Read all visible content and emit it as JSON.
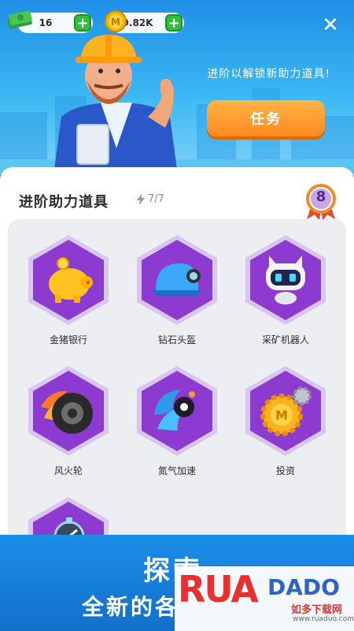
{
  "resources": {
    "cash_value": "16",
    "coin_value": "9.82K",
    "plus_label": "+"
  },
  "hero": {
    "prompt": "进阶以解锁新助力道具!",
    "task_button": "任务",
    "close_label": "✕"
  },
  "panel": {
    "title": "进阶助力道具",
    "charges": "7/7",
    "level": "8"
  },
  "items": [
    {
      "label": "金猪银行",
      "icon": "piggy-bank-icon"
    },
    {
      "label": "钻石头盔",
      "icon": "drill-helmet-icon"
    },
    {
      "label": "采矿机器人",
      "icon": "mining-robot-icon"
    },
    {
      "label": "风火轮",
      "icon": "flame-wheel-icon"
    },
    {
      "label": "氮气加速",
      "icon": "nitro-boost-icon"
    },
    {
      "label": "投资",
      "icon": "investment-gear-icon"
    },
    {
      "label": "",
      "icon": "stopwatch-icon"
    }
  ],
  "banner": {
    "headline": "探索",
    "subline": "全新的各"
  },
  "watermark": {
    "logo": "RUA",
    "logo2": "DADO",
    "cn": "如多下载网",
    "url": "www.ruaduo.com"
  },
  "colors": {
    "accent_orange": "#ff8a1f",
    "plus_green": "#2fbf3a",
    "hex_purple": "#7b2bc4",
    "panel_bg": "#eceef2",
    "banner_blue": "#136fca"
  }
}
